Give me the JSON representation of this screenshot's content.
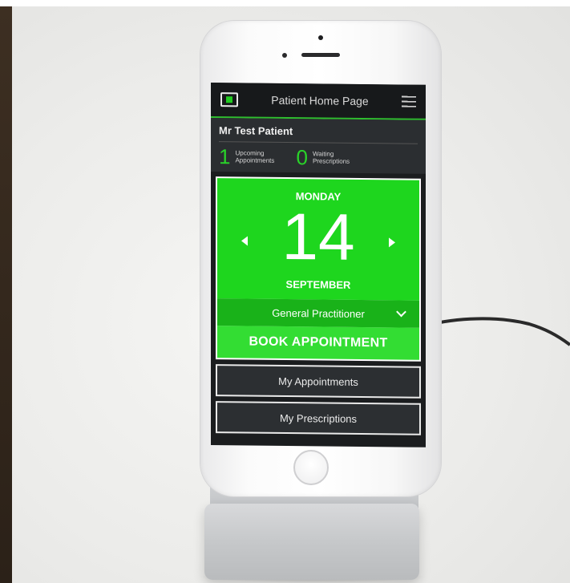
{
  "app": {
    "title": "Patient Home Page"
  },
  "patient": {
    "name": "Mr Test Patient",
    "stats": [
      {
        "value": "1",
        "label": "Upcoming Appointments"
      },
      {
        "value": "0",
        "label": "Waiting Prescriptions"
      }
    ]
  },
  "calendar": {
    "weekday": "MONDAY",
    "day": "14",
    "month": "SEPTEMBER"
  },
  "booking": {
    "service_selected": "General Practitioner",
    "book_label": "BOOK APPOINTMENT"
  },
  "nav": {
    "appointments_label": "My Appointments",
    "prescriptions_label": "My Prescriptions"
  },
  "colors": {
    "accent_green": "#1ed61e",
    "header_dark": "#17191b"
  },
  "icons": [
    "app-logo-icon",
    "menu-icon",
    "prev-day-icon",
    "next-day-icon",
    "chevron-down-icon"
  ]
}
